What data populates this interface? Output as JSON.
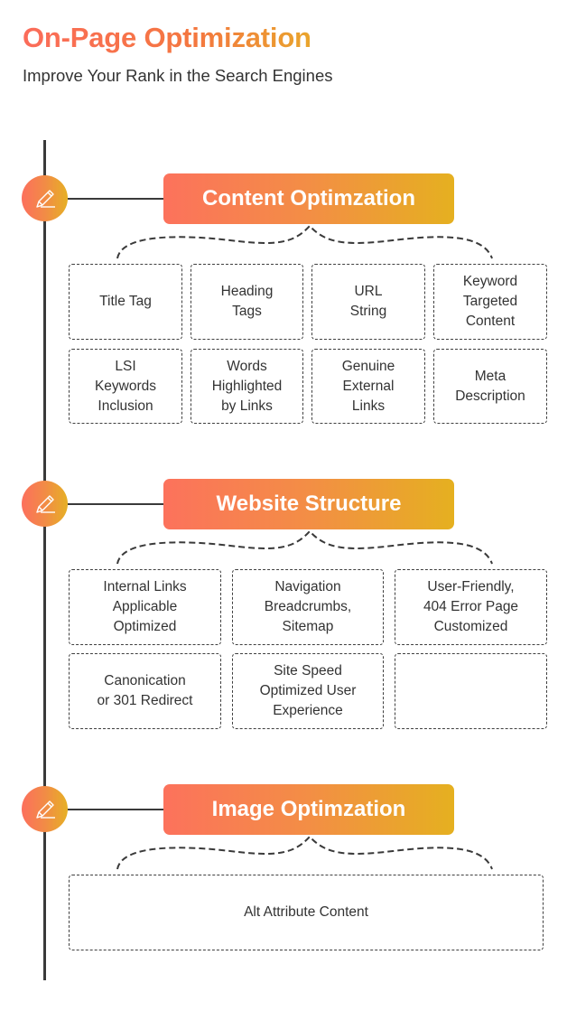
{
  "header": {
    "title": "On-Page Optimization",
    "subtitle": "Improve Your Rank in the Search Engines"
  },
  "colors": {
    "gradient_start": "#fc725c",
    "gradient_end": "#e5b020",
    "line": "#3a3a3a",
    "text": "#333333"
  },
  "sections": [
    {
      "icon": "pencil-icon",
      "title": "Content Optimzation",
      "items": [
        "Title  Tag",
        "Heading\nTags",
        "URL\nString",
        "Keyword\nTargeted\nContent",
        "LSI\nKeywords\nInclusion",
        "Words\nHighlighted\nby Links",
        "Genuine\nExternal\nLinks",
        "Meta\nDescription"
      ]
    },
    {
      "icon": "pencil-icon",
      "title": "Website Structure",
      "items": [
        "Internal Links\nApplicable\nOptimized",
        "Navigation\nBreadcrumbs,\nSitemap",
        "User-Friendly,\n404 Error Page\nCustomized",
        "Canonication\nor 301 Redirect",
        "Site Speed\nOptimized User\nExperience",
        ""
      ]
    },
    {
      "icon": "pencil-icon",
      "title": "Image Optimzation",
      "items": [
        "Alt Attribute Content"
      ]
    }
  ]
}
